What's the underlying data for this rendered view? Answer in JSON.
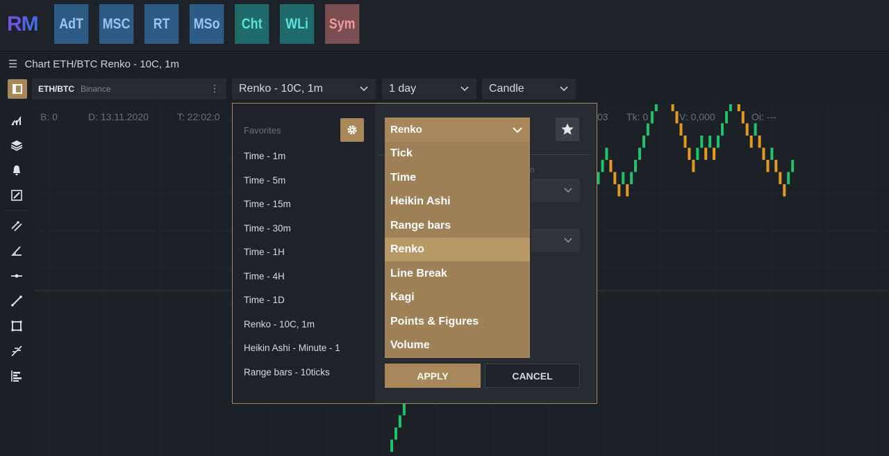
{
  "app": {
    "logo": "RM",
    "buttons": [
      {
        "label": "AdT",
        "bg": "#2c5c86",
        "fg": "#9dc4ea"
      },
      {
        "label": "MSC",
        "bg": "#2c5c86",
        "fg": "#9dc4ea"
      },
      {
        "label": "RT",
        "bg": "#2c5c86",
        "fg": "#9dc4ea"
      },
      {
        "label": "MSo",
        "bg": "#2c5c86",
        "fg": "#9dc4ea"
      },
      {
        "label": "Cht",
        "bg": "#1f6b6b",
        "fg": "#5fe0d9"
      },
      {
        "label": "WLi",
        "bg": "#1f6b6b",
        "fg": "#5fe0d9"
      },
      {
        "label": "Sym",
        "bg": "#7b4f52",
        "fg": "#f09aa0"
      }
    ]
  },
  "window": {
    "title": "Chart ETH/BTC Renko - 10C, 1m",
    "menu_icon": "hamburger-icon"
  },
  "toolbar": {
    "symbol": "ETH/BTC",
    "exchange": "Binance",
    "more": "⋮",
    "chart_type": "Renko - 10C, 1m",
    "period": "1 day",
    "style": "Candle"
  },
  "info_strip": {
    "b": "B: 0",
    "d": "D: 13.11.2020",
    "t": "T: 22:02:0",
    "c_tail": "03",
    "tk": "Tk: 0",
    "v": "V: 0,000",
    "oi": "Oi: ---"
  },
  "left_tools": [
    "indicators-icon",
    "layers-icon",
    "alert-bell-icon",
    "edit-drawing-icon",
    "parallel-lines-icon",
    "angle-icon",
    "horizontal-line-icon",
    "trend-line-icon",
    "rectangle-icon",
    "fibonacci-icon",
    "volume-profile-icon"
  ],
  "popup": {
    "favorites_title": "Favorites",
    "favorites": [
      "Time - 1m",
      "Time - 5m",
      "Time - 15m",
      "Time - 30m",
      "Time - 1H",
      "Time - 4H",
      "Time - 1D",
      "Renko - 10C, 1m",
      "Heikin Ashi - Minute - 1",
      "Range bars - 10ticks"
    ],
    "selected_type": "Renko",
    "options": [
      "Tick",
      "Time",
      "Heikin Ashi",
      "Range bars",
      "Renko",
      "Line Break",
      "Kagi",
      "Points & Figures",
      "Volume"
    ],
    "active_option": "Renko",
    "apply_label": "APPLY",
    "cancel_label": "CANCEL"
  },
  "colors": {
    "accent": "#a8885a",
    "bull": "#1fc36a",
    "bear": "#e39a1e",
    "background": "#1b1f26"
  },
  "chart_data": {
    "type": "renko",
    "bricks": [
      1,
      1,
      1,
      1,
      1,
      1,
      1,
      1,
      1,
      1,
      1,
      -1,
      -1,
      1,
      1,
      1,
      1,
      1,
      1,
      1,
      1,
      1,
      1,
      1,
      1,
      1,
      1,
      1,
      1,
      1,
      1,
      1,
      1,
      1,
      1,
      -1,
      -1,
      -1,
      -1,
      -1,
      -1,
      -1,
      -1,
      -1,
      -1,
      -1,
      -1,
      1,
      1,
      1,
      1,
      1,
      1,
      -1,
      -1,
      -1,
      1,
      -1,
      1,
      1,
      1,
      1,
      1,
      1,
      1,
      1,
      1,
      -1,
      -1,
      -1,
      -1,
      -1,
      -1,
      -1,
      1,
      1,
      -1,
      1,
      -1,
      1,
      1,
      1,
      1,
      1,
      -1,
      -1,
      -1,
      -1,
      1,
      -1,
      -1,
      -1,
      1,
      -1,
      -1,
      -1,
      1,
      1
    ]
  }
}
